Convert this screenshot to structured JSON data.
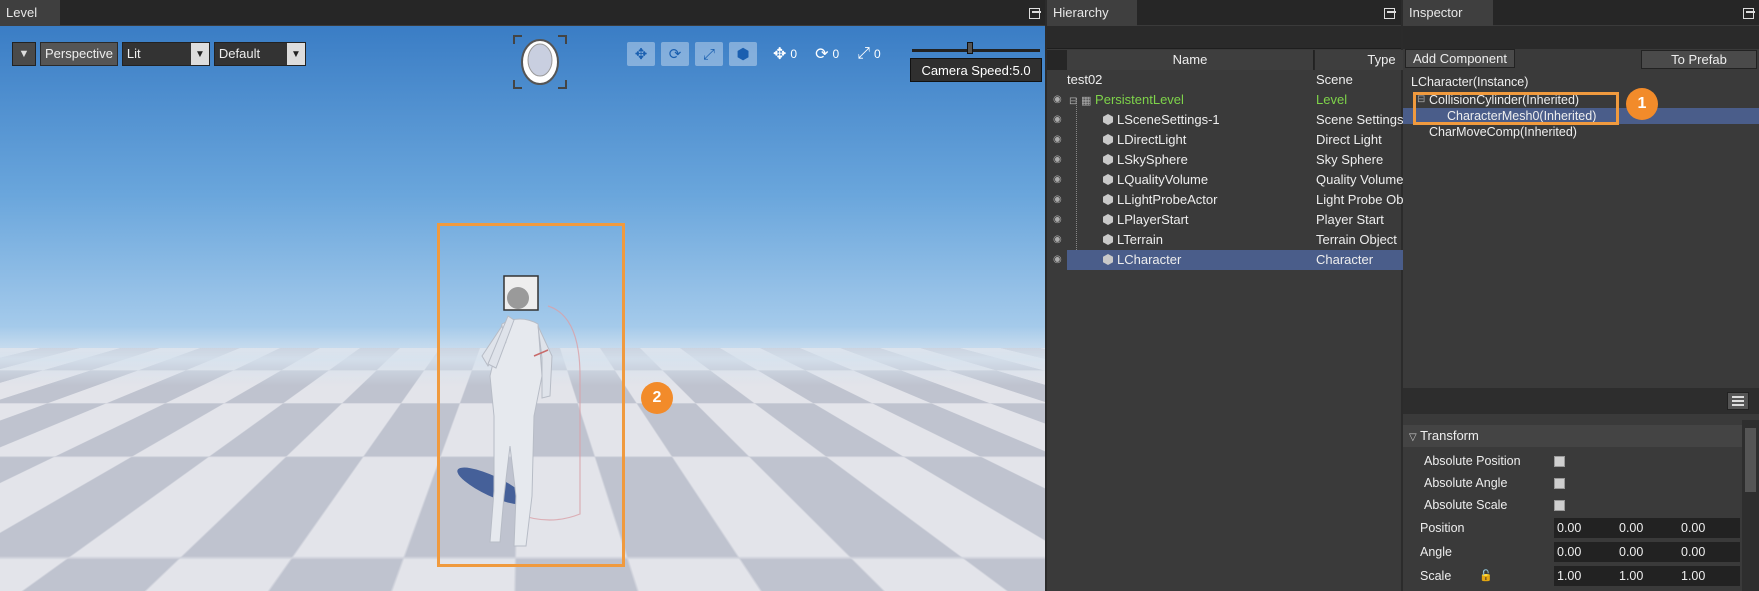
{
  "level": {
    "tab_title": "Level",
    "toolbar": {
      "view_mode": "Perspective",
      "lighting_mode": "Lit",
      "render_preset": "Default"
    },
    "snap": {
      "position": "0",
      "rotation": "0",
      "scale": "0"
    },
    "camera_speed_label": "Camera Speed:5.0",
    "camera_speed_fraction": 0.45,
    "annotation_2": "2"
  },
  "hierarchy": {
    "tab_title": "Hierarchy",
    "columns": [
      "Name",
      "Type"
    ],
    "rows": [
      {
        "name": "test02",
        "type": "Scene"
      },
      {
        "name": "PersistentLevel",
        "type": "Level"
      },
      {
        "name": "LSceneSettings-1",
        "type": "Scene Settings"
      },
      {
        "name": "LDirectLight",
        "type": "Direct Light"
      },
      {
        "name": "LSkySphere",
        "type": "Sky Sphere"
      },
      {
        "name": "LQualityVolume",
        "type": "Quality Volume"
      },
      {
        "name": "LLightProbeActor",
        "type": "Light Probe Object"
      },
      {
        "name": "LPlayerStart",
        "type": "Player Start"
      },
      {
        "name": "LTerrain",
        "type": "Terrain Object"
      },
      {
        "name": "LCharacter",
        "type": "Character"
      }
    ],
    "selected_index": 9
  },
  "inspector": {
    "tab_title": "Inspector",
    "add_component": "Add Component",
    "to_prefab": "To Prefab",
    "components": [
      "LCharacter(Instance)",
      "CollisionCylinder(Inherited)",
      "CharacterMesh0(Inherited)",
      "CharMoveComp(Inherited)"
    ],
    "annotation_1": "1",
    "section_title": "Transform",
    "flags": [
      {
        "label": "Absolute Position"
      },
      {
        "label": "Absolute Angle"
      },
      {
        "label": "Absolute Scale"
      }
    ],
    "vectors": [
      {
        "label": "Position",
        "x": "0.00",
        "y": "0.00",
        "z": "0.00"
      },
      {
        "label": "Angle",
        "x": "0.00",
        "y": "0.00",
        "z": "0.00"
      },
      {
        "label": "Scale",
        "x": "1.00",
        "y": "1.00",
        "z": "1.00"
      }
    ]
  },
  "colors": {
    "accent_orange": "#f09a3e",
    "selection_blue": "#4a5d8a",
    "level_green": "#7ed34a"
  }
}
